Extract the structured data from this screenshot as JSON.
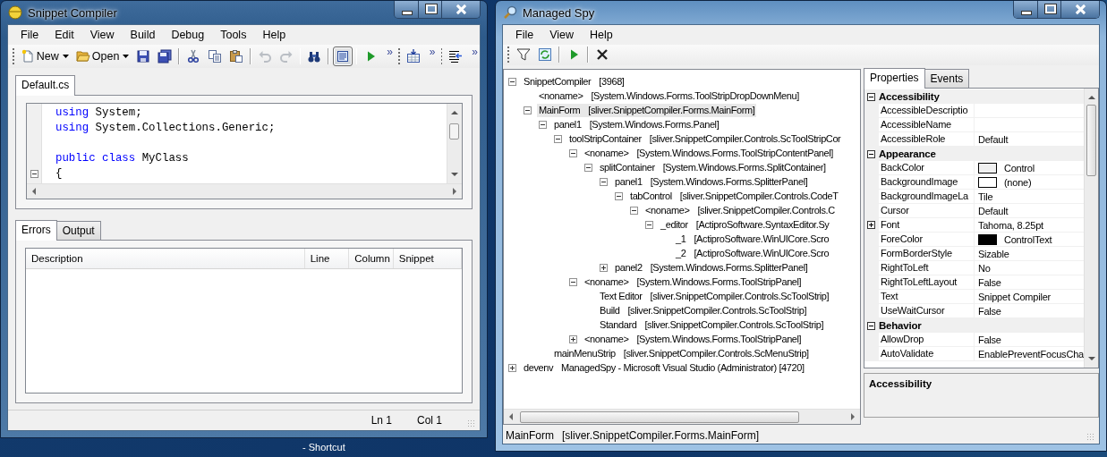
{
  "snippet_window": {
    "title": "Snippet Compiler",
    "menu": [
      "File",
      "Edit",
      "View",
      "Build",
      "Debug",
      "Tools",
      "Help"
    ],
    "toolbar": [
      {
        "kind": "grip"
      },
      {
        "kind": "new",
        "label": "New",
        "dropdown": true,
        "disabled": false,
        "pressed": false
      },
      {
        "kind": "open",
        "label": "Open",
        "dropdown": true,
        "disabled": false,
        "pressed": false
      },
      {
        "kind": "save",
        "disabled": false,
        "pressed": false
      },
      {
        "kind": "save-all",
        "disabled": false,
        "pressed": false
      },
      {
        "kind": "separator"
      },
      {
        "kind": "cut",
        "disabled": false,
        "pressed": false
      },
      {
        "kind": "copy",
        "disabled": false,
        "pressed": false
      },
      {
        "kind": "paste",
        "disabled": false,
        "pressed": false
      },
      {
        "kind": "separator"
      },
      {
        "kind": "undo",
        "disabled": true,
        "pressed": false
      },
      {
        "kind": "redo",
        "disabled": true,
        "pressed": false
      },
      {
        "kind": "separator"
      },
      {
        "kind": "find",
        "disabled": false,
        "pressed": false
      },
      {
        "kind": "separator"
      },
      {
        "kind": "view",
        "disabled": false,
        "pressed": true
      },
      {
        "kind": "separator"
      },
      {
        "kind": "run",
        "disabled": false,
        "pressed": false
      },
      {
        "kind": "overflow",
        "label": "»"
      },
      {
        "kind": "grip"
      },
      {
        "kind": "build",
        "disabled": false,
        "pressed": false
      },
      {
        "kind": "overflow",
        "label": "»"
      },
      {
        "kind": "grip"
      },
      {
        "kind": "align",
        "disabled": false,
        "pressed": false
      },
      {
        "kind": "overflow",
        "label": "»"
      }
    ],
    "doc_tabs": [
      {
        "label": "Default.cs",
        "selected": true
      }
    ],
    "code": [
      {
        "fold": false,
        "tokens": [
          {
            "kind": "keyword",
            "text": "using"
          },
          {
            "kind": "plain",
            "text": " System;"
          }
        ]
      },
      {
        "fold": false,
        "tokens": [
          {
            "kind": "keyword",
            "text": "using"
          },
          {
            "kind": "plain",
            "text": " System.Collections.Generic;"
          }
        ]
      },
      {
        "fold": false
      },
      {
        "fold": false,
        "tokens": [
          {
            "kind": "keyword",
            "text": "public"
          },
          {
            "kind": "keyword",
            "text": " class"
          },
          {
            "kind": "plain",
            "text": " MyClass"
          }
        ]
      },
      {
        "fold": true,
        "tokens": [
          {
            "kind": "plain",
            "text": "{"
          }
        ]
      }
    ],
    "panel_tabs": [
      {
        "label": "Errors",
        "selected": true
      },
      {
        "label": "Output",
        "selected": false
      }
    ],
    "errors_table": {
      "columns": [
        "Description",
        "Line",
        "Column",
        "Snippet"
      ]
    },
    "status_bar": [
      "Ln 1",
      "Col 1"
    ]
  },
  "spy_window": {
    "title": "Managed Spy",
    "menu": [
      "File",
      "View",
      "Help"
    ],
    "toolbar": [
      {
        "kind": "filter"
      },
      {
        "kind": "refresh"
      },
      {
        "kind": "separator"
      },
      {
        "kind": "run"
      },
      {
        "kind": "separator"
      },
      {
        "kind": "delete"
      }
    ],
    "tree": [
      {
        "name": "SnippetCompiler",
        "type": "[3968]",
        "expanded": true,
        "selected": false,
        "children": [
          {
            "name": "<noname>",
            "type": "[System.Windows.Forms.ToolStripDropDownMenu]",
            "selected": false
          },
          {
            "name": "MainForm",
            "type": "[sliver.SnippetCompiler.Forms.MainForm]",
            "expanded": true,
            "selected": true,
            "children": [
              {
                "name": "panel1",
                "type": "[System.Windows.Forms.Panel]",
                "expanded": true,
                "selected": false,
                "children": [
                  {
                    "name": "toolStripContainer",
                    "type": "[sliver.SnippetCompiler.Controls.ScToolStripCor",
                    "expanded": true,
                    "selected": false,
                    "children": [
                      {
                        "name": "<noname>",
                        "type": "[System.Windows.Forms.ToolStripContentPanel]",
                        "expanded": true,
                        "selected": false,
                        "children": [
                          {
                            "name": "splitContainer",
                            "type": "[System.Windows.Forms.SplitContainer]",
                            "expanded": true,
                            "selected": false,
                            "children": [
                              {
                                "name": "panel1",
                                "type": "[System.Windows.Forms.SplitterPanel]",
                                "expanded": true,
                                "selected": false,
                                "children": [
                                  {
                                    "name": "tabControl",
                                    "type": "[sliver.SnippetCompiler.Controls.CodeT",
                                    "expanded": true,
                                    "selected": false,
                                    "children": [
                                      {
                                        "name": "<noname>",
                                        "type": "[sliver.SnippetCompiler.Controls.C",
                                        "expanded": true,
                                        "selected": false,
                                        "children": [
                                          {
                                            "name": "_editor",
                                            "type": "[ActiproSoftware.SyntaxEditor.Sy",
                                            "expanded": true,
                                            "selected": false,
                                            "children": [
                                              {
                                                "name": "_1",
                                                "type": "[ActiproSoftware.WinUICore.Scro",
                                                "selected": false
                                              },
                                              {
                                                "name": "_2",
                                                "type": "[ActiproSoftware.WinUICore.Scro",
                                                "selected": false
                                              }
                                            ]
                                          }
                                        ]
                                      }
                                    ]
                                  }
                                ]
                              },
                              {
                                "name": "panel2",
                                "type": "[System.Windows.Forms.SplitterPanel]",
                                "expanded": false,
                                "selected": false
                              }
                            ]
                          }
                        ]
                      },
                      {
                        "name": "<noname>",
                        "type": "[System.Windows.Forms.ToolStripPanel]",
                        "expanded": true,
                        "selected": false,
                        "children": [
                          {
                            "name": "Text Editor",
                            "type": "[sliver.SnippetCompiler.Controls.ScToolStrip]",
                            "selected": false
                          },
                          {
                            "name": "Build",
                            "type": "[sliver.SnippetCompiler.Controls.ScToolStrip]",
                            "selected": false
                          },
                          {
                            "name": "Standard",
                            "type": "[sliver.SnippetCompiler.Controls.ScToolStrip]",
                            "selected": false
                          }
                        ]
                      },
                      {
                        "name": "<noname>",
                        "type": "[System.Windows.Forms.ToolStripPanel]",
                        "expanded": false,
                        "selected": false
                      }
                    ]
                  }
                ]
              },
              {
                "name": "mainMenuStrip",
                "type": "[sliver.SnippetCompiler.Controls.ScMenuStrip]",
                "selected": false
              }
            ]
          }
        ]
      },
      {
        "name": "devenv",
        "type": "ManagedSpy - Microsoft Visual Studio (Administrator) [4720]",
        "expanded": false,
        "selected": false
      }
    ],
    "property_tabs": [
      {
        "label": "Properties",
        "selected": true
      },
      {
        "label": "Events",
        "selected": false
      }
    ],
    "property_grid": [
      {
        "category": "Accessibility",
        "expanded": true,
        "rows": [
          {
            "name": "AccessibleDescriptio"
          },
          {
            "name": "AccessibleName"
          },
          {
            "name": "AccessibleRole",
            "value": "Default"
          }
        ]
      },
      {
        "category": "Appearance",
        "expanded": true,
        "rows": [
          {
            "name": "BackColor",
            "value": "Control",
            "color": "#f0f0f0"
          },
          {
            "name": "BackgroundImage",
            "value": "(none)",
            "color": "#ffffff"
          },
          {
            "name": "BackgroundImageLa",
            "value": "Tile"
          },
          {
            "name": "Cursor",
            "value": "Default"
          },
          {
            "name": "Font",
            "value": "Tahoma, 8.25pt",
            "expanded": false
          },
          {
            "name": "ForeColor",
            "value": "ControlText",
            "color": "#000000"
          },
          {
            "name": "FormBorderStyle",
            "value": "Sizable"
          },
          {
            "name": "RightToLeft",
            "value": "No"
          },
          {
            "name": "RightToLeftLayout",
            "value": "False"
          },
          {
            "name": "Text",
            "value": "Snippet Compiler"
          },
          {
            "name": "UseWaitCursor",
            "value": "False"
          }
        ]
      },
      {
        "category": "Behavior",
        "expanded": true,
        "rows": [
          {
            "name": "AllowDrop",
            "value": "False"
          },
          {
            "name": "AutoValidate",
            "value": "EnablePreventFocusCha"
          }
        ]
      }
    ],
    "description": {
      "title": "Accessibility"
    },
    "status_bar": {
      "name": "MainForm",
      "type": "[sliver.SnippetCompiler.Forms.MainForm]"
    }
  },
  "desktop": {
    "shortcut_label": "- Shortcut"
  }
}
